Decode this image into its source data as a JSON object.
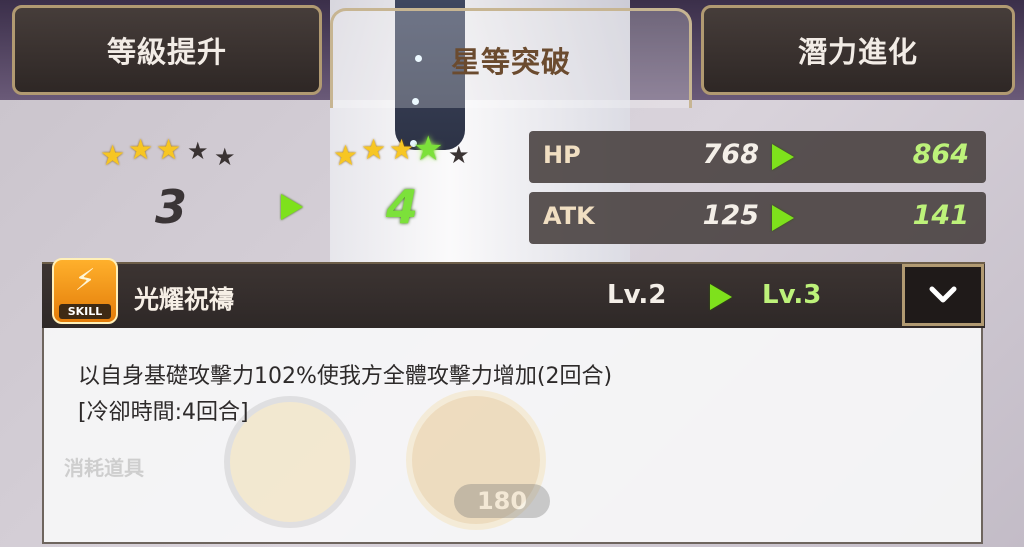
{
  "tabs": [
    {
      "label": "等級提升",
      "active": false
    },
    {
      "label": "星等突破",
      "active": true
    },
    {
      "label": "潛力進化",
      "active": false
    }
  ],
  "star_breakthrough": {
    "current_stars": 3,
    "next_stars": 4,
    "max_stars": 5,
    "current_label": "3",
    "next_label": "4"
  },
  "stats": [
    {
      "label": "HP",
      "old": "768",
      "new": "864"
    },
    {
      "label": "ATK",
      "old": "125",
      "new": "141"
    }
  ],
  "skill": {
    "icon_tag": "SKILL",
    "name": "光耀祝禱",
    "level_old": "Lv.2",
    "level_new": "Lv.3",
    "description_line1": "以自身基礎攻擊力102%使我方全體攻擊力增加(2回合)",
    "description_line2": "[冷卻時間:4回合]"
  },
  "background": {
    "consumables_label": "消耗道具",
    "item_count": "180"
  },
  "colors": {
    "accent_green": "#7ee11c",
    "gold_border": "#b19a72",
    "new_value": "#bdf27a"
  }
}
